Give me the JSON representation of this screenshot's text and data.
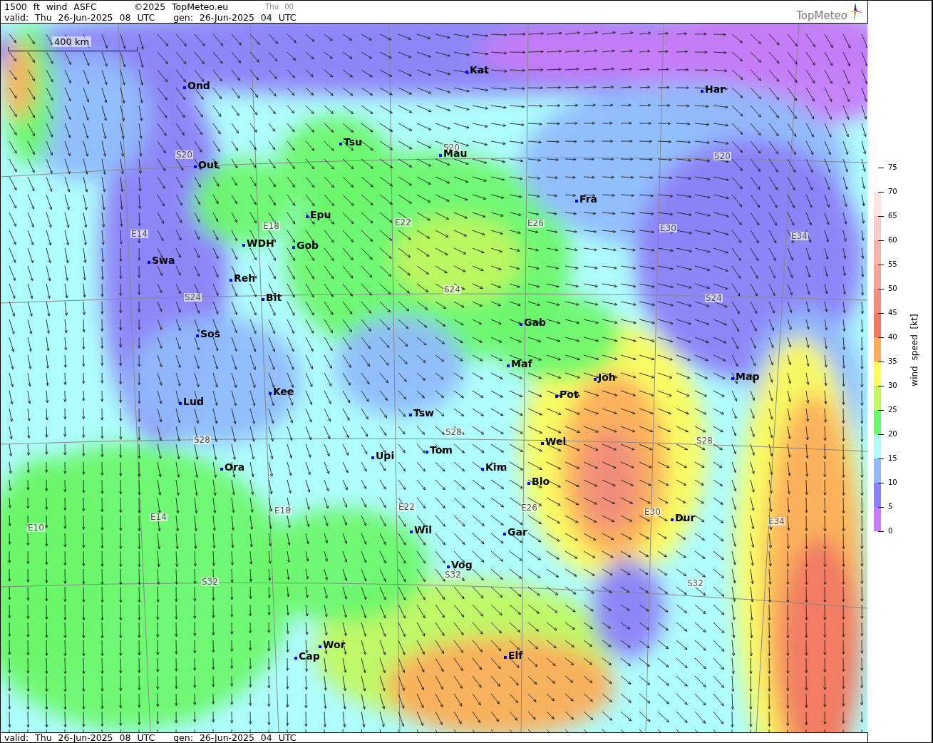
{
  "header": {
    "title": "1500 ft wind ASFC",
    "copyright": "©2025 TopMeteo.eu",
    "run": "Thu 00",
    "valid": "valid: Thu 26-Jun-2025 08 UTC",
    "generated": "gen: 26-Jun-2025 04 UTC",
    "logo": "TopMeteo"
  },
  "map": {
    "scale": "400 km",
    "cities": [
      {
        "name": "Ond"
      },
      {
        "name": "Kat"
      },
      {
        "name": "Har"
      },
      {
        "name": "Tsu"
      },
      {
        "name": "Mau"
      },
      {
        "name": "Out"
      },
      {
        "name": "Fra"
      },
      {
        "name": "Epu"
      },
      {
        "name": "WDH"
      },
      {
        "name": "Gob"
      },
      {
        "name": "Swa"
      },
      {
        "name": "Reh"
      },
      {
        "name": "Bit"
      },
      {
        "name": "Gab"
      },
      {
        "name": "Sos"
      },
      {
        "name": "Maf"
      },
      {
        "name": "Joh"
      },
      {
        "name": "Map"
      },
      {
        "name": "Pot"
      },
      {
        "name": "Kee"
      },
      {
        "name": "Lud"
      },
      {
        "name": "Tsw"
      },
      {
        "name": "Wel"
      },
      {
        "name": "Tom"
      },
      {
        "name": "Upi"
      },
      {
        "name": "Kim"
      },
      {
        "name": "Ora"
      },
      {
        "name": "Blo"
      },
      {
        "name": "Dur"
      },
      {
        "name": "Wil"
      },
      {
        "name": "Gar"
      },
      {
        "name": "Vog"
      },
      {
        "name": "Wor"
      },
      {
        "name": "Elf"
      },
      {
        "name": "Cap"
      }
    ],
    "grid_labels": [
      "S20",
      "S20",
      "S20",
      "E14",
      "E18",
      "E22",
      "E26",
      "E30",
      "E34",
      "S24",
      "S24",
      "S24",
      "S28",
      "S28",
      "S28",
      "E14",
      "E18",
      "E22",
      "E26",
      "E30",
      "E34",
      "E10",
      "S32",
      "S32",
      "S32"
    ]
  },
  "legend": {
    "title": "wind speed [kt]",
    "ticks": [
      "75",
      "70",
      "65",
      "60",
      "55",
      "50",
      "45",
      "40",
      "35",
      "30",
      "25",
      "20",
      "15",
      "10",
      "5",
      "0"
    ],
    "bands": [
      {
        "color": "#c77cf8"
      },
      {
        "color": "#8c80f8"
      },
      {
        "color": "#90bafc"
      },
      {
        "color": "#aefcfc"
      },
      {
        "color": "#6cf86c"
      },
      {
        "color": "#c0f860"
      },
      {
        "color": "#fcfc5c"
      },
      {
        "color": "#fcae5c"
      },
      {
        "color": "#f07864"
      },
      {
        "color": "#f08c7c"
      },
      {
        "color": "#f4a49c"
      },
      {
        "color": "#f4b4ac"
      },
      {
        "color": "#f8ccc8"
      },
      {
        "color": "#fce4e0"
      }
    ]
  },
  "footer": {
    "valid": "valid: Thu 26-Jun-2025 08 UTC",
    "generated": "gen: 26-Jun-2025 04 UTC"
  }
}
